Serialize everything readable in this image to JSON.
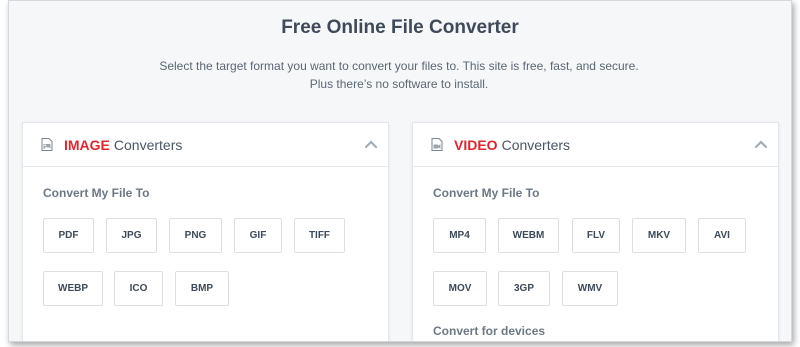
{
  "header": {
    "title": "Free Online File Converter",
    "subtitle": "Select the target format you want to convert your files to. This site is free, fast, and secure. Plus there’s no software to install."
  },
  "image_card": {
    "accent": "IMAGE",
    "title": "Converters",
    "icon": "image-file-icon",
    "section_label": "Convert My File To",
    "formats": [
      "PDF",
      "JPG",
      "PNG",
      "GIF",
      "TIFF",
      "WEBP",
      "ICO",
      "BMP"
    ]
  },
  "video_card": {
    "accent": "VIDEO",
    "title": "Converters",
    "icon": "video-file-icon",
    "section_label": "Convert My File To",
    "formats": [
      "MP4",
      "WEBM",
      "FLV",
      "MKV",
      "AVI",
      "MOV",
      "3GP",
      "WMV"
    ],
    "devices_label": "Convert for devices"
  },
  "colors": {
    "accent": "#e0262d",
    "text": "#3e4a59",
    "background": "#f6f7f9"
  }
}
